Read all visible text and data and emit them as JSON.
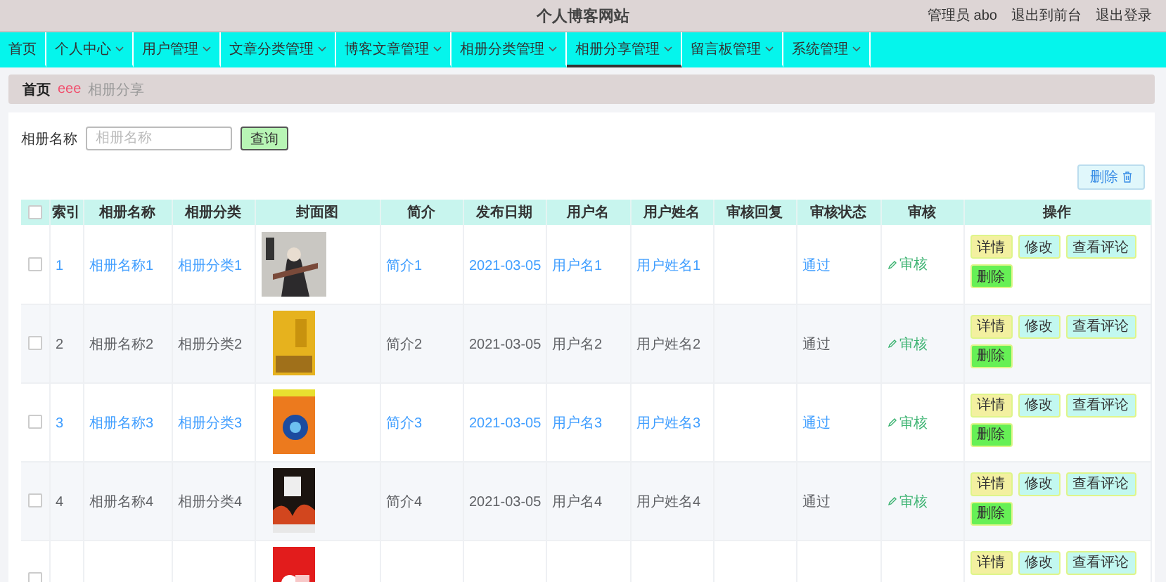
{
  "header": {
    "title": "个人博客网站",
    "user": "管理员 abo",
    "links": [
      "退出到前台",
      "退出登录"
    ]
  },
  "nav": [
    {
      "label": "首页",
      "dropdown": false,
      "selected": false
    },
    {
      "label": "个人中心",
      "dropdown": true,
      "selected": false
    },
    {
      "label": "用户管理",
      "dropdown": true,
      "selected": false
    },
    {
      "label": "文章分类管理",
      "dropdown": true,
      "selected": false
    },
    {
      "label": "博客文章管理",
      "dropdown": true,
      "selected": false
    },
    {
      "label": "相册分类管理",
      "dropdown": true,
      "selected": false
    },
    {
      "label": "相册分享管理",
      "dropdown": true,
      "selected": true
    },
    {
      "label": "留言板管理",
      "dropdown": true,
      "selected": false
    },
    {
      "label": "系统管理",
      "dropdown": true,
      "selected": false
    }
  ],
  "breadcrumb": {
    "home": "首页",
    "separator": "eee",
    "current": "相册分享"
  },
  "search": {
    "label": "相册名称",
    "placeholder": "相册名称",
    "button": "查询"
  },
  "delete_button": "删除",
  "table": {
    "all_checked": false,
    "columns": [
      "索引",
      "相册名称",
      "相册分类",
      "封面图",
      "简介",
      "发布日期",
      "用户名",
      "用户姓名",
      "审核回复",
      "审核状态",
      "审核",
      "操作"
    ],
    "rows": [
      {
        "checked": false,
        "index": "1",
        "name": "相册名称1",
        "category": "相册分类1",
        "cover": {
          "kind": "picture"
        },
        "intro": "简介1",
        "date": "2021-03-05",
        "username": "用户名1",
        "realname": "用户姓名1",
        "status": "通过",
        "review": "审核",
        "actions": [
          {
            "label": "详情",
            "kind": "detail"
          },
          {
            "label": "修改",
            "kind": "edit"
          },
          {
            "label": "查看评论",
            "kind": "comments"
          },
          {
            "label": "删除",
            "kind": "delete"
          }
        ]
      },
      {
        "checked": false,
        "index": "2",
        "name": "相册名称2",
        "category": "相册分类2",
        "cover": {
          "kind": "picture"
        },
        "intro": "简介2",
        "date": "2021-03-05",
        "username": "用户名2",
        "realname": "用户姓名2",
        "status": "通过",
        "review": "审核",
        "actions": [
          {
            "label": "详情",
            "kind": "detail"
          },
          {
            "label": "修改",
            "kind": "edit"
          },
          {
            "label": "查看评论",
            "kind": "comments"
          },
          {
            "label": "删除",
            "kind": "delete"
          }
        ]
      },
      {
        "checked": false,
        "index": "3",
        "name": "相册名称3",
        "category": "相册分类3",
        "cover": {
          "kind": "picture"
        },
        "intro": "简介3",
        "date": "2021-03-05",
        "username": "用户名3",
        "realname": "用户姓名3",
        "status": "通过",
        "review": "审核",
        "actions": [
          {
            "label": "详情",
            "kind": "detail"
          },
          {
            "label": "修改",
            "kind": "edit"
          },
          {
            "label": "查看评论",
            "kind": "comments"
          },
          {
            "label": "删除",
            "kind": "delete"
          }
        ]
      },
      {
        "checked": false,
        "index": "4",
        "name": "相册名称4",
        "category": "相册分类4",
        "cover": {
          "kind": "picture"
        },
        "intro": "简介4",
        "date": "2021-03-05",
        "username": "用户名4",
        "realname": "用户姓名4",
        "status": "通过",
        "review": "审核",
        "actions": [
          {
            "label": "详情",
            "kind": "detail"
          },
          {
            "label": "修改",
            "kind": "edit"
          },
          {
            "label": "查看评论",
            "kind": "comments"
          },
          {
            "label": "删除",
            "kind": "delete"
          }
        ]
      },
      {
        "checked": false,
        "cover": {
          "kind": "picture"
        },
        "actions": [
          {
            "label": "详情",
            "kind": "detail"
          },
          {
            "label": "修改",
            "kind": "edit"
          },
          {
            "label": "查看评论",
            "kind": "comments"
          }
        ]
      }
    ]
  }
}
